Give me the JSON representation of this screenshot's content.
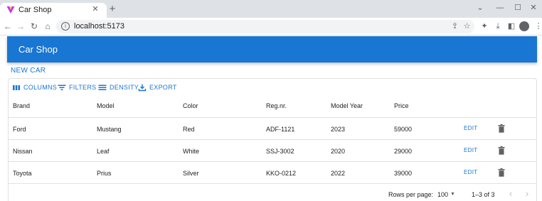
{
  "browser": {
    "tab_title": "Car Shop",
    "url": "localhost:5173",
    "favicon_colors": [
      "#bd34fe",
      "#ffcf48"
    ]
  },
  "app": {
    "title": "Car Shop",
    "new_car_label": "NEW CAR",
    "accent_color": "#1976d2"
  },
  "grid_toolbar": [
    {
      "label": "COLUMNS",
      "icon": "view-column-icon"
    },
    {
      "label": "FILTERS",
      "icon": "filter-list-icon"
    },
    {
      "label": "DENSITY",
      "icon": "density-icon"
    },
    {
      "label": "EXPORT",
      "icon": "export-icon"
    }
  ],
  "columns": [
    "Brand",
    "Model",
    "Color",
    "Reg.nr.",
    "Model Year",
    "Price"
  ],
  "rows": [
    {
      "brand": "Ford",
      "model": "Mustang",
      "color": "Red",
      "reg": "ADF-1121",
      "year": "2023",
      "price": "59000",
      "edit": "EDIT"
    },
    {
      "brand": "Nissan",
      "model": "Leaf",
      "color": "White",
      "reg": "SSJ-3002",
      "year": "2020",
      "price": "29000",
      "edit": "EDIT"
    },
    {
      "brand": "Toyota",
      "model": "Prius",
      "color": "Silver",
      "reg": "KKO-0212",
      "year": "2022",
      "price": "39000",
      "edit": "EDIT"
    }
  ],
  "pagination": {
    "rows_per_page_label": "Rows per page:",
    "rows_per_page_value": "100",
    "range_text": "1–3 of 3"
  }
}
